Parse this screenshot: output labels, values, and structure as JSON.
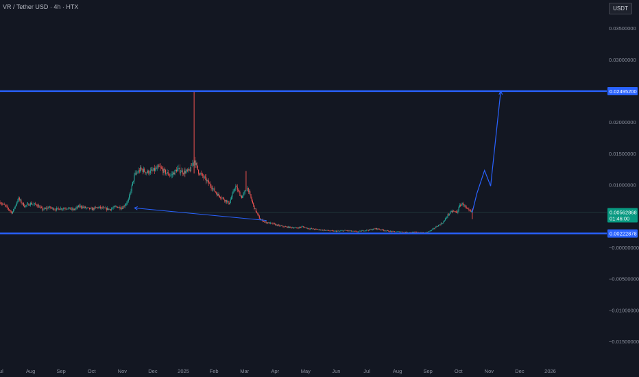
{
  "header": {
    "symbol_title": "VR / Tether USD · 4h · HTX",
    "currency": "USDT"
  },
  "colors": {
    "background": "#131722",
    "level_line": "#2962ff",
    "up_candle": "#26a69a",
    "down_candle": "#ef5350",
    "projection": "#2962ff",
    "current_price_badge": "#089981"
  },
  "chart_data": {
    "type": "candlestick",
    "y_ticks": [
      {
        "value": 0.035,
        "label": "0.03500000"
      },
      {
        "value": 0.03,
        "label": "0.03000000"
      },
      {
        "value": 0.02,
        "label": "0.02000000"
      },
      {
        "value": 0.015,
        "label": "0.01500000"
      },
      {
        "value": 0.01,
        "label": "0.01000000"
      },
      {
        "value": -0.0,
        "label": "−0.00000000"
      },
      {
        "value": -0.005,
        "label": "−0.00500000"
      },
      {
        "value": -0.01,
        "label": "−0.01000000"
      },
      {
        "value": -0.015,
        "label": "−0.01500000"
      }
    ],
    "ylim": [
      -0.0185,
      0.0395
    ],
    "x_ticks": [
      "Jul",
      "Aug",
      "Sep",
      "Oct",
      "Nov",
      "Dec",
      "2025",
      "Feb",
      "Mar",
      "Apr",
      "May",
      "Jun",
      "Jul",
      "Aug",
      "Sep",
      "Oct",
      "Nov",
      "Dec",
      "2026"
    ],
    "x_tick_months": [
      -6,
      -5,
      -4,
      -3,
      -2,
      -1,
      0,
      1,
      2,
      3,
      4,
      5,
      6,
      7,
      8,
      9,
      10,
      11,
      12
    ],
    "xlim_months": [
      -6,
      13.85
    ],
    "levels": [
      {
        "value": 0.024952,
        "label": "0.02495200"
      },
      {
        "value": 0.00222878,
        "label": "0.00222878"
      }
    ],
    "current_price": {
      "value": 0.00562868,
      "label": "0.00562868",
      "countdown": "01:46:00"
    },
    "price_path": [
      [
        -6.0,
        0.0072
      ],
      [
        -5.8,
        0.0065
      ],
      [
        -5.6,
        0.0055
      ],
      [
        -5.4,
        0.0078
      ],
      [
        -5.2,
        0.0066
      ],
      [
        -5.0,
        0.007
      ],
      [
        -4.8,
        0.0068
      ],
      [
        -4.6,
        0.006
      ],
      [
        -4.4,
        0.0064
      ],
      [
        -4.2,
        0.0061
      ],
      [
        -4.0,
        0.0062
      ],
      [
        -3.8,
        0.0063
      ],
      [
        -3.6,
        0.006
      ],
      [
        -3.4,
        0.0066
      ],
      [
        -3.2,
        0.0063
      ],
      [
        -3.0,
        0.0061
      ],
      [
        -2.8,
        0.0064
      ],
      [
        -2.6,
        0.0062
      ],
      [
        -2.4,
        0.0061
      ],
      [
        -2.2,
        0.0065
      ],
      [
        -2.0,
        0.0063
      ],
      [
        -1.8,
        0.0075
      ],
      [
        -1.6,
        0.0115
      ],
      [
        -1.4,
        0.0125
      ],
      [
        -1.2,
        0.012
      ],
      [
        -1.0,
        0.0122
      ],
      [
        -0.8,
        0.0128
      ],
      [
        -0.6,
        0.012
      ],
      [
        -0.4,
        0.0115
      ],
      [
        -0.2,
        0.0125
      ],
      [
        0.0,
        0.012
      ],
      [
        0.2,
        0.0122
      ],
      [
        0.35,
        0.014
      ],
      [
        0.5,
        0.012
      ],
      [
        0.7,
        0.011
      ],
      [
        0.9,
        0.0098
      ],
      [
        1.1,
        0.0085
      ],
      [
        1.3,
        0.0078
      ],
      [
        1.5,
        0.007
      ],
      [
        1.7,
        0.0098
      ],
      [
        1.9,
        0.008
      ],
      [
        2.1,
        0.0095
      ],
      [
        2.3,
        0.0065
      ],
      [
        2.5,
        0.0045
      ],
      [
        2.7,
        0.004
      ],
      [
        2.9,
        0.0038
      ],
      [
        3.1,
        0.0035
      ],
      [
        3.3,
        0.0033
      ],
      [
        3.5,
        0.0032
      ],
      [
        3.7,
        0.0031
      ],
      [
        3.9,
        0.0033
      ],
      [
        4.1,
        0.003
      ],
      [
        4.3,
        0.0029
      ],
      [
        4.5,
        0.0028
      ],
      [
        4.7,
        0.0027
      ],
      [
        4.9,
        0.0026
      ],
      [
        5.1,
        0.0026
      ],
      [
        5.3,
        0.0027
      ],
      [
        5.5,
        0.0026
      ],
      [
        5.7,
        0.0025
      ],
      [
        5.9,
        0.0027
      ],
      [
        6.1,
        0.0028
      ],
      [
        6.3,
        0.003
      ],
      [
        6.5,
        0.0028
      ],
      [
        6.7,
        0.0026
      ],
      [
        6.9,
        0.0025
      ],
      [
        7.1,
        0.0025
      ],
      [
        7.3,
        0.0024
      ],
      [
        7.5,
        0.0024
      ],
      [
        7.7,
        0.0024
      ],
      [
        7.9,
        0.0023
      ],
      [
        8.1,
        0.0027
      ],
      [
        8.3,
        0.0034
      ],
      [
        8.5,
        0.004
      ],
      [
        8.65,
        0.0052
      ],
      [
        8.8,
        0.0058
      ],
      [
        8.95,
        0.0056
      ],
      [
        9.05,
        0.0068
      ],
      [
        9.15,
        0.007
      ],
      [
        9.25,
        0.0062
      ],
      [
        9.35,
        0.0058
      ],
      [
        9.45,
        0.0056
      ]
    ],
    "spikes": [
      {
        "x": 0.35,
        "high": 0.0249,
        "low": 0.0118
      },
      {
        "x": 2.05,
        "high": 0.0122,
        "low": 0.0092
      },
      {
        "x": 9.45,
        "high": 0.0062,
        "low": 0.0045
      }
    ],
    "projection_path": [
      [
        9.45,
        0.0056
      ],
      [
        9.6,
        0.0086
      ],
      [
        9.85,
        0.0123
      ],
      [
        10.05,
        0.0098
      ],
      [
        10.38,
        0.02495
      ]
    ],
    "annotation_arrow": {
      "from": [
        2.72,
        0.0043
      ],
      "to": [
        -1.6,
        0.0063
      ]
    }
  }
}
